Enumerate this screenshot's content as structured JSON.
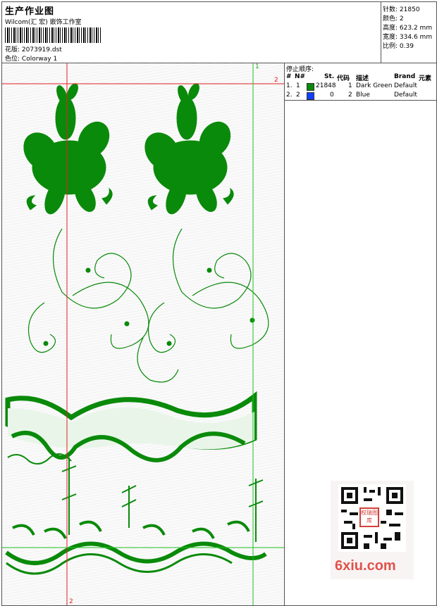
{
  "header": {
    "title": "生产作业图",
    "company": "Wilcom(汇 宏) 嵌饰工作室",
    "design_label": "花版:",
    "design_value": "2073919.dst",
    "colorway_label": "色位:",
    "colorway_value": "Colorway 1"
  },
  "stats": [
    {
      "label": "针数:",
      "value": "21850"
    },
    {
      "label": "颜色:",
      "value": "2"
    },
    {
      "label": "高度:",
      "value": "623.2 mm"
    },
    {
      "label": "宽度:",
      "value": "334.6 mm"
    },
    {
      "label": "比例:",
      "value": "0.39"
    }
  ],
  "stop_sequence": {
    "title": "停止顺序:",
    "headers": [
      "#",
      "N#",
      "St.",
      "代码",
      "描述",
      "Brand",
      "元素"
    ],
    "rows": [
      {
        "num": "1.",
        "n": "1",
        "color": "#0a8a0a",
        "stitches": "21848",
        "code": "1",
        "description": "Dark Green",
        "brand": "Default"
      },
      {
        "num": "2.",
        "n": "2",
        "color": "#1040ff",
        "stitches": "0",
        "code": "2",
        "description": "Blue",
        "brand": "Default"
      }
    ]
  },
  "canvas": {
    "markers": {
      "red_top": "2",
      "green_top": "1",
      "red_bottom": "2",
      "red_left_top": "2"
    },
    "embroidery_color": "#0a8a0a"
  },
  "watermark": {
    "seal": "权瑞图库",
    "text": "6xiu.com"
  }
}
